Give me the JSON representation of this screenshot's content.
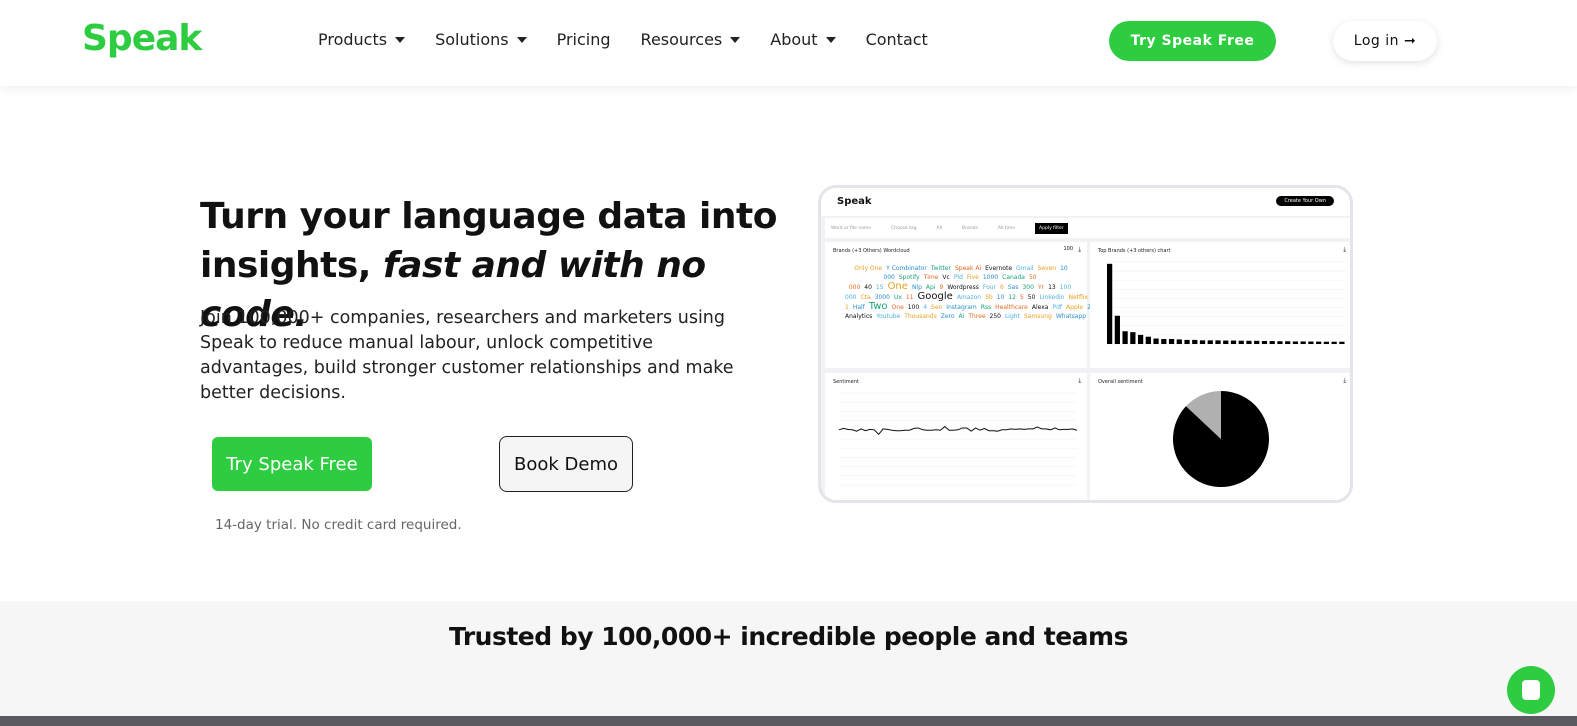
{
  "header": {
    "logo": "Speak",
    "nav": [
      {
        "label": "Products",
        "dropdown": true
      },
      {
        "label": "Solutions",
        "dropdown": true
      },
      {
        "label": "Pricing",
        "dropdown": false
      },
      {
        "label": "Resources",
        "dropdown": true
      },
      {
        "label": "About",
        "dropdown": true
      },
      {
        "label": "Contact",
        "dropdown": false
      }
    ],
    "try_label": "Try Speak Free",
    "login_label": "Log in",
    "login_icon": "arrow-right-icon"
  },
  "hero": {
    "title_1": "Turn your language data into",
    "title_2a": "insights, ",
    "title_2b": "fast and with no code.",
    "subtitle": "Join 100,000+ companies, researchers and marketers using Speak to reduce manual labour, unlock competitive advantages, build stronger customer relationships and make better decisions.",
    "cta_primary": "Try Speak Free",
    "cta_secondary": "Book Demo",
    "trial_note": "14-day trial. No credit card required."
  },
  "dashboard": {
    "logo": "Speak",
    "create": "Create Your Own",
    "filters": [
      "Word or file name",
      "Choose tag",
      "All",
      "Brands",
      "All time"
    ],
    "apply": "Apply filter",
    "wordcloud_title": "Brands (+3 Others) Wordcloud",
    "wordcloud_count": "100",
    "bar_title": "Top Brands (+3 others) chart",
    "sentiment_title": "Sentiment",
    "pie_title": "Overall sentiment",
    "words": [
      "Only One",
      "Y Combinator",
      "Twitter",
      "Speak Ai",
      "Evernote",
      "Gmail",
      "Seven",
      "10 000",
      "Spotify",
      "Time",
      "Vc",
      "Pld",
      "Five",
      "1000",
      "Canada",
      "50 000",
      "40",
      "15",
      "One",
      "Nlp",
      "Api",
      "9",
      "Wordpress",
      "Four",
      "6",
      "Sas",
      "300",
      "Yr",
      "13",
      "100 000",
      "Cta",
      "3000",
      "Ux",
      "11",
      "Google",
      "Amazon",
      "Sb",
      "10",
      "12",
      "5",
      "50",
      "Linkedin",
      "Netflix",
      "Tyler",
      "Github",
      "Toronto",
      "Mvp",
      "Ios",
      "Sprint 1",
      "Half",
      "Two",
      "One",
      "100",
      "4",
      "Seo",
      "Instagram",
      "Rss",
      "Healthcare",
      "Alexa",
      "Pdf",
      "Apple",
      "20",
      "Xyz",
      "Three",
      "Two",
      "Dmz",
      "30",
      "Microsoft",
      "Lauren",
      "Hubspot",
      "Disney",
      "8",
      "Ten",
      "Ui",
      "2",
      "Justin",
      "500",
      "Intercom",
      "7",
      "25",
      "Chrome",
      "200",
      "Facebook",
      "65",
      "3",
      "Hundreds",
      "Nft",
      "Android",
      "Google Analytics",
      "Youtube",
      "Thousands",
      "Zero",
      "Ai",
      "Three",
      "250",
      "Light",
      "Samsung",
      "Whatsapp",
      "Niehaus"
    ],
    "word_colors": [
      "#e8a020",
      "#2a8fcc",
      "#1aa37a",
      "#e06a20",
      "#111",
      "#4fb0e0"
    ]
  },
  "chart_data": [
    {
      "type": "bar",
      "title": "Top Brands (+3 others) chart",
      "ylim": [
        0,
        900
      ],
      "values": [
        880,
        310,
        140,
        130,
        100,
        80,
        60,
        55,
        55,
        50,
        45,
        45,
        40,
        40,
        40,
        38,
        38,
        36,
        35,
        35,
        33,
        32,
        30,
        30,
        28,
        28,
        27,
        26,
        25,
        25,
        25
      ],
      "grid": true
    },
    {
      "type": "line",
      "title": "Sentiment",
      "ylim": [
        -1,
        1
      ],
      "values": [
        0.2,
        0.23,
        0.21,
        0.2,
        0.17,
        0.22,
        0.18,
        0.21,
        0.2,
        0.1,
        0.22,
        0.21,
        0.19,
        0.18,
        0.18,
        0.19,
        0.19,
        0.23,
        0.24,
        0.2,
        0.19,
        0.19,
        0.2,
        0.19,
        0.27,
        0.19,
        0.19,
        0.2,
        0.24,
        0.24,
        0.17,
        0.24,
        0.19,
        0.23,
        0.18,
        0.18,
        0.17,
        0.2,
        0.2,
        0.22,
        0.21,
        0.22,
        0.21,
        0.22,
        0.22,
        0.26,
        0.22,
        0.22,
        0.2,
        0.24,
        0.2,
        0.21,
        0.21,
        0.22,
        0.19
      ],
      "grid": true
    },
    {
      "type": "pie",
      "title": "Overall sentiment",
      "values": [
        87,
        13
      ],
      "colors": [
        "#000000",
        "#b0b0b0"
      ]
    }
  ],
  "trusted": {
    "title": "Trusted by 100,000+ incredible people and teams"
  },
  "chat": {
    "icon": "chat-icon"
  },
  "colors": {
    "brand": "#2ecc40"
  }
}
